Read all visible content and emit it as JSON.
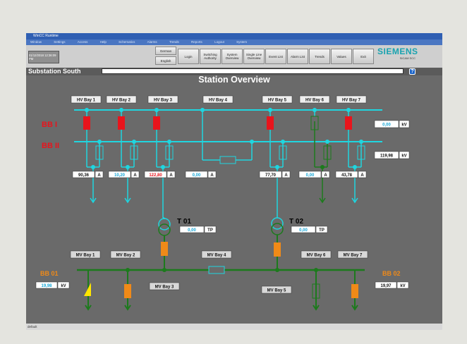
{
  "window": {
    "title": "WinCC Runtime"
  },
  "menu": [
    "Window",
    "Settings",
    "Access",
    "Help",
    "Schematics",
    "Alarms",
    "Trends",
    "Reports",
    "Logout",
    "System"
  ],
  "toolbar": {
    "datetime": "01/12/2018 12:36:09 PM",
    "buttons": [
      "German",
      "English",
      "Login",
      "Switching Authority",
      "System Overview",
      "Single Line Overview",
      "Event List",
      "Alarm List",
      "Trends",
      "Values",
      "Exit"
    ]
  },
  "brand": {
    "name": "SIEMENS",
    "sub": "SICAM SCC"
  },
  "site": {
    "name": "Substation South",
    "field_value": "",
    "help_label": "?"
  },
  "page_title": "Station Overview",
  "busbars": {
    "hv1": "BB I",
    "hv2": "BB II",
    "mv1": "BB 01",
    "mv2": "BB 02"
  },
  "hv_bays": [
    "HV Bay 1",
    "HV Bay 2",
    "HV Bay 3",
    "HV Bay 4",
    "HV Bay 5",
    "HV Bay 6",
    "HV Bay 7"
  ],
  "hv_voltages": [
    {
      "value": "0,00",
      "unit": "kV"
    },
    {
      "value": "119,98",
      "unit": "kV"
    }
  ],
  "currents": [
    {
      "value": "90,36",
      "unit": "A"
    },
    {
      "value": "10,20",
      "unit": "A"
    },
    {
      "value": "122,80",
      "unit": "A"
    },
    {
      "value": "0,00",
      "unit": "A"
    },
    {
      "value": "77,70",
      "unit": "A"
    },
    {
      "value": "0,00",
      "unit": "A"
    },
    {
      "value": "43,78",
      "unit": "A"
    }
  ],
  "transformers": [
    {
      "name": "T 01",
      "value": "0,00",
      "unit": "TP"
    },
    {
      "name": "T 02",
      "value": "0,00",
      "unit": "TP"
    }
  ],
  "mv_bays": [
    "MV Bay 1",
    "MV Bay 2",
    "MV Bay 3",
    "MV Bay 4",
    "MV Bay 5",
    "MV Bay 6",
    "MV Bay 7"
  ],
  "mv_voltages": [
    {
      "value": "19,98",
      "unit": "kV"
    },
    {
      "value": "19,97",
      "unit": "kV"
    }
  ],
  "status": "default",
  "colors": {
    "hv_line": "#1fd6e0",
    "mv_line": "#1c7a1c",
    "breaker_closed_hv": "#e8141c",
    "breaker_mv": "#f08a18",
    "busbar_label_hv": "#e8141c",
    "busbar_label_mv": "#f08a18",
    "value_text": "#18a8d8",
    "value_alarm": "#e8141c"
  }
}
